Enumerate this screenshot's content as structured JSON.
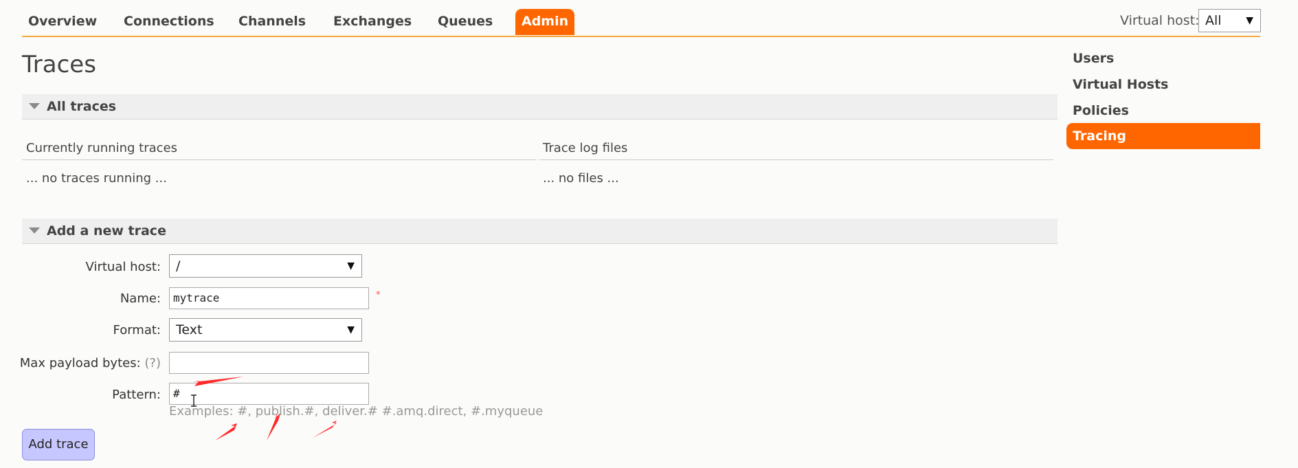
{
  "nav": {
    "items": [
      {
        "label": "Overview"
      },
      {
        "label": "Connections"
      },
      {
        "label": "Channels"
      },
      {
        "label": "Exchanges"
      },
      {
        "label": "Queues"
      },
      {
        "label": "Admin",
        "active": true
      }
    ],
    "vhost_label": "Virtual host:",
    "vhost_value": "All"
  },
  "page": {
    "title": "Traces"
  },
  "all_traces": {
    "header": "All traces",
    "running_head": "Currently running traces",
    "running_value": "... no traces running ...",
    "files_head": "Trace log files",
    "files_value": "... no files ..."
  },
  "add_trace": {
    "header": "Add a new trace",
    "vhost_label": "Virtual host:",
    "vhost_value": "/",
    "name_label": "Name:",
    "name_value": "mytrace",
    "required_mark": "*",
    "format_label": "Format:",
    "format_value": "Text",
    "max_payload_label": "Max payload bytes:",
    "help_mark": "(?)",
    "max_payload_value": "",
    "pattern_label": "Pattern:",
    "pattern_value": "#",
    "examples": "Examples: #, publish.#, deliver.# #.amq.direct, #.myqueue",
    "submit_label": "Add trace"
  },
  "sidebar": {
    "items": [
      {
        "label": "Users"
      },
      {
        "label": "Virtual Hosts"
      },
      {
        "label": "Policies"
      },
      {
        "label": "Tracing",
        "active": true
      }
    ]
  },
  "colors": {
    "accent": "#ff6600",
    "nav_border": "#f7a73b",
    "button": "#c7c7ff",
    "annotation": "#ff2a2a"
  }
}
